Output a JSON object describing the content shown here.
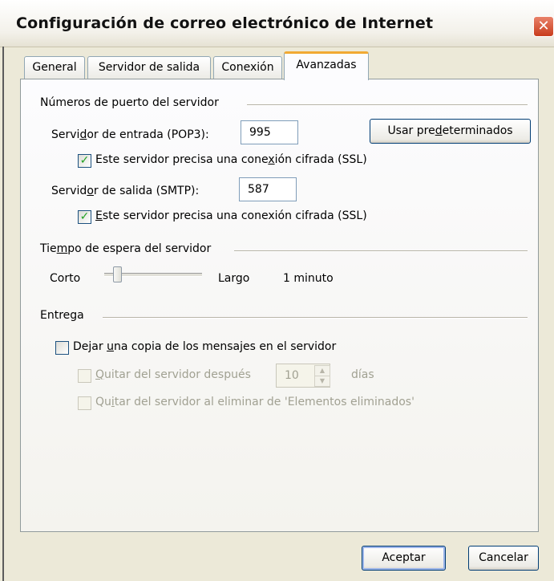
{
  "window": {
    "title": "Configuración de correo electrónico de Internet",
    "close_glyph": "✕"
  },
  "tabs": [
    {
      "label": "General",
      "active": false
    },
    {
      "label": "Servidor de salida",
      "active": false
    },
    {
      "label": "Conexión",
      "active": false
    },
    {
      "label": "Avanzadas",
      "active": true
    }
  ],
  "ports_group": {
    "title": "Números de puerto del servidor",
    "incoming_label_pre": "Servi",
    "incoming_label_u": "d",
    "incoming_label_post": "or de entrada (POP3):",
    "incoming_value": "995",
    "default_button_pre": "Usar pre",
    "default_button_u": "d",
    "default_button_post": "eterminados",
    "incoming_ssl_label_pre": "Este servidor precisa una cone",
    "incoming_ssl_label_u": "x",
    "incoming_ssl_label_post": "ión cifrada (SSL)",
    "incoming_ssl_checked": true,
    "outgoing_label_pre": "Servid",
    "outgoing_label_u": "o",
    "outgoing_label_post": "r de salida (SMTP):",
    "outgoing_value": "587",
    "outgoing_ssl_label_pre": "",
    "outgoing_ssl_label_u": "E",
    "outgoing_ssl_label_post": "ste servidor precisa una conexión cifrada (SSL)",
    "outgoing_ssl_checked": true
  },
  "timeout_group": {
    "title_pre": "Tie",
    "title_u": "m",
    "title_post": "po de espera del servidor",
    "short_label": "Corto",
    "long_label": "Largo",
    "value_text": "1 minuto",
    "slider_level_fraction": 0.1
  },
  "delivery_group": {
    "title": "Entrega",
    "leave_copy_pre": "Dejar ",
    "leave_copy_u": "u",
    "leave_copy_post": "na copia de los mensajes en el servidor",
    "leave_copy_checked": false,
    "remove_after_pre": "",
    "remove_after_u": "Q",
    "remove_after_post": "uitar del servidor después",
    "remove_after_checked": false,
    "days_value": "10",
    "days_label": "días",
    "remove_deleted_pre": "Qu",
    "remove_deleted_u": "i",
    "remove_deleted_post": "tar del servidor al eliminar de 'Elementos eliminados'",
    "remove_deleted_checked": false
  },
  "footer": {
    "ok_label": "Aceptar",
    "cancel_label": "Cancelar"
  },
  "colors": {
    "dialog_bg": "#ECE9D8",
    "panel_bg": "#FCFCFE",
    "active_tab_accent": "#F1A933",
    "check_green": "#21A121",
    "close_red": "#C83C1C"
  }
}
